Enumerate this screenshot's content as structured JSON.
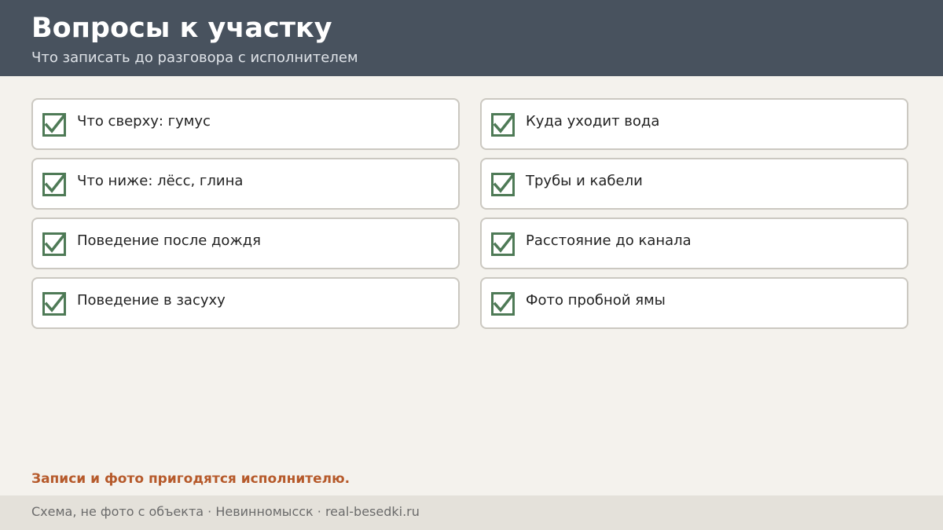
{
  "header": {
    "title": "Вопросы к участку",
    "subtitle": "Что записать до разговора с исполнителем"
  },
  "checklist": [
    {
      "label": "Что сверху: гумус",
      "checked": true
    },
    {
      "label": "Куда уходит вода",
      "checked": true
    },
    {
      "label": "Что ниже: лёсс, глина",
      "checked": true
    },
    {
      "label": "Трубы и кабели",
      "checked": true
    },
    {
      "label": "Поведение после дождя",
      "checked": true
    },
    {
      "label": "Расстояние до канала",
      "checked": true
    },
    {
      "label": "Поведение в засуху",
      "checked": true
    },
    {
      "label": "Фото пробной ямы",
      "checked": true
    }
  ],
  "note": "Записи и фото пригодятся исполнителю.",
  "footer": {
    "text": "Схема, не фото с объекта  ·  Невинномысск  ·  real-besedki.ru"
  },
  "colors": {
    "header_bg": "#48525e",
    "check_color": "#4e7a56",
    "note_color": "#b65a2b"
  }
}
